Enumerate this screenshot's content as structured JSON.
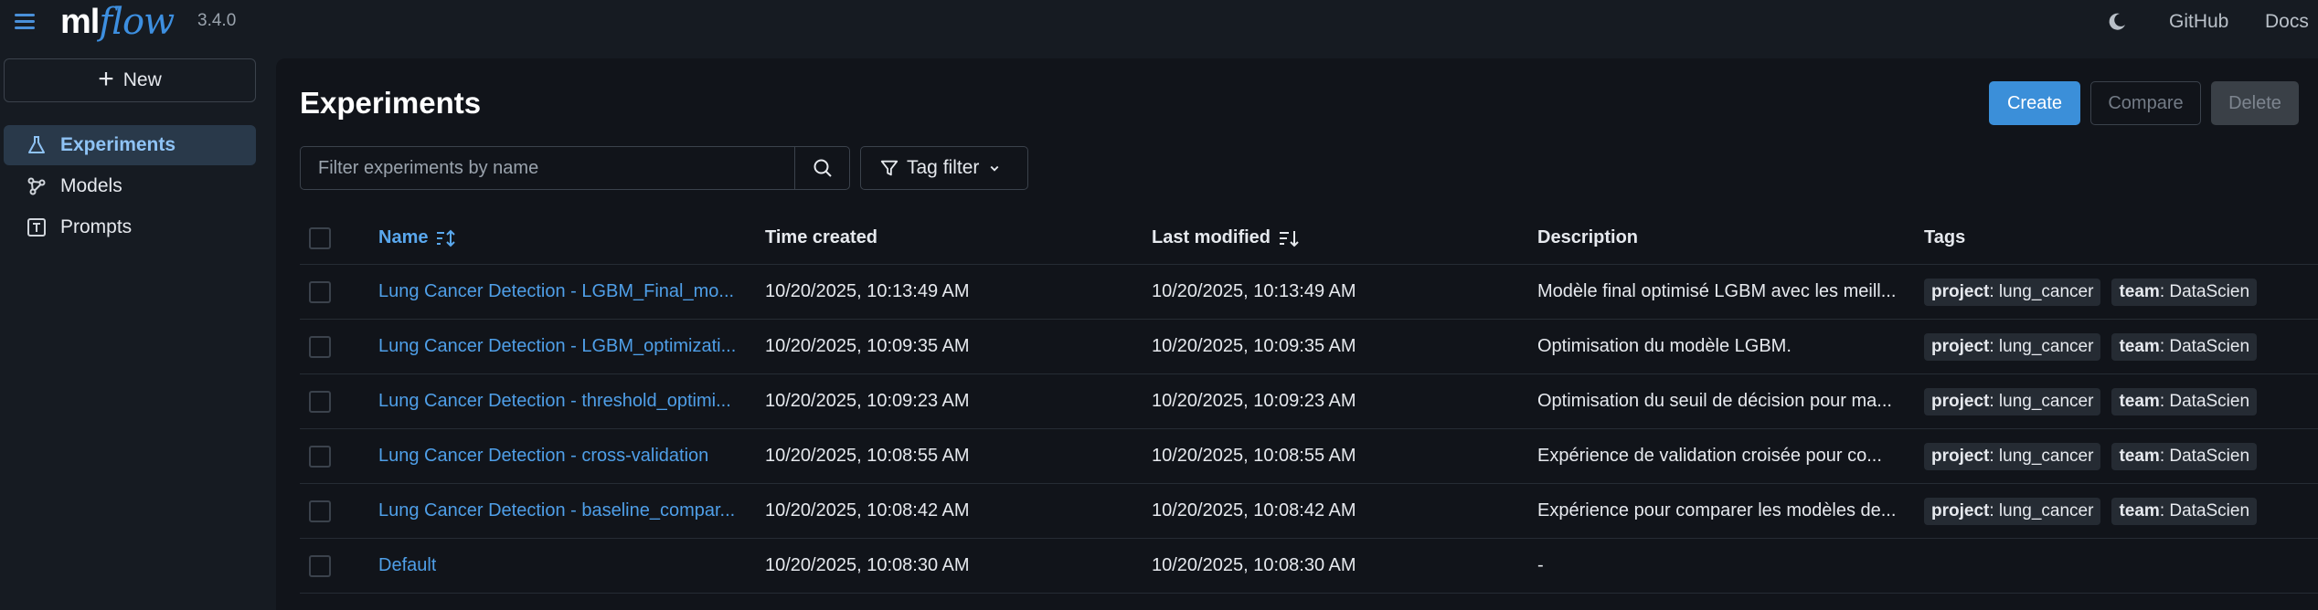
{
  "app": {
    "version": "3.4.0",
    "logo_ml": "ml",
    "logo_flow": "flow"
  },
  "topbar": {
    "github_label": "GitHub",
    "docs_label": "Docs"
  },
  "sidebar": {
    "new_label": "New",
    "items": [
      {
        "label": "Experiments",
        "icon": "beaker-icon",
        "active": true
      },
      {
        "label": "Models",
        "icon": "models-icon",
        "active": false
      },
      {
        "label": "Prompts",
        "icon": "prompt-icon",
        "active": false
      }
    ]
  },
  "main": {
    "title": "Experiments",
    "create_label": "Create",
    "compare_label": "Compare",
    "delete_label": "Delete",
    "search_placeholder": "Filter experiments by name",
    "tag_filter_label": "Tag filter"
  },
  "table": {
    "columns": {
      "name": "Name",
      "time_created": "Time created",
      "last_modified": "Last modified",
      "description": "Description",
      "tags": "Tags"
    },
    "rows": [
      {
        "name": "Lung Cancer Detection - LGBM_Final_mo...",
        "time_created": "10/20/2025, 10:13:49 AM",
        "last_modified": "10/20/2025, 10:13:49 AM",
        "description": "Modèle final optimisé LGBM avec les meill...",
        "tags": [
          {
            "key": "project",
            "value": "lung_cancer"
          },
          {
            "key": "team",
            "value": "DataScien"
          }
        ]
      },
      {
        "name": "Lung Cancer Detection - LGBM_optimizati...",
        "time_created": "10/20/2025, 10:09:35 AM",
        "last_modified": "10/20/2025, 10:09:35 AM",
        "description": "Optimisation du modèle LGBM.",
        "tags": [
          {
            "key": "project",
            "value": "lung_cancer"
          },
          {
            "key": "team",
            "value": "DataScien"
          }
        ]
      },
      {
        "name": "Lung Cancer Detection - threshold_optimi...",
        "time_created": "10/20/2025, 10:09:23 AM",
        "last_modified": "10/20/2025, 10:09:23 AM",
        "description": "Optimisation du seuil de décision pour ma...",
        "tags": [
          {
            "key": "project",
            "value": "lung_cancer"
          },
          {
            "key": "team",
            "value": "DataScien"
          }
        ]
      },
      {
        "name": "Lung Cancer Detection - cross-validation",
        "time_created": "10/20/2025, 10:08:55 AM",
        "last_modified": "10/20/2025, 10:08:55 AM",
        "description": "Expérience de validation croisée pour co...",
        "tags": [
          {
            "key": "project",
            "value": "lung_cancer"
          },
          {
            "key": "team",
            "value": "DataScien"
          }
        ]
      },
      {
        "name": "Lung Cancer Detection - baseline_compar...",
        "time_created": "10/20/2025, 10:08:42 AM",
        "last_modified": "10/20/2025, 10:08:42 AM",
        "description": "Expérience pour comparer les modèles de...",
        "tags": [
          {
            "key": "project",
            "value": "lung_cancer"
          },
          {
            "key": "team",
            "value": "DataScien"
          }
        ]
      },
      {
        "name": "Default",
        "time_created": "10/20/2025, 10:08:30 AM",
        "last_modified": "10/20/2025, 10:08:30 AM",
        "description": "-",
        "tags": []
      }
    ]
  },
  "colors": {
    "accent": "#3b8fd9",
    "link": "#4f9fe8",
    "background": "#161b22",
    "panel": "#11141a"
  }
}
